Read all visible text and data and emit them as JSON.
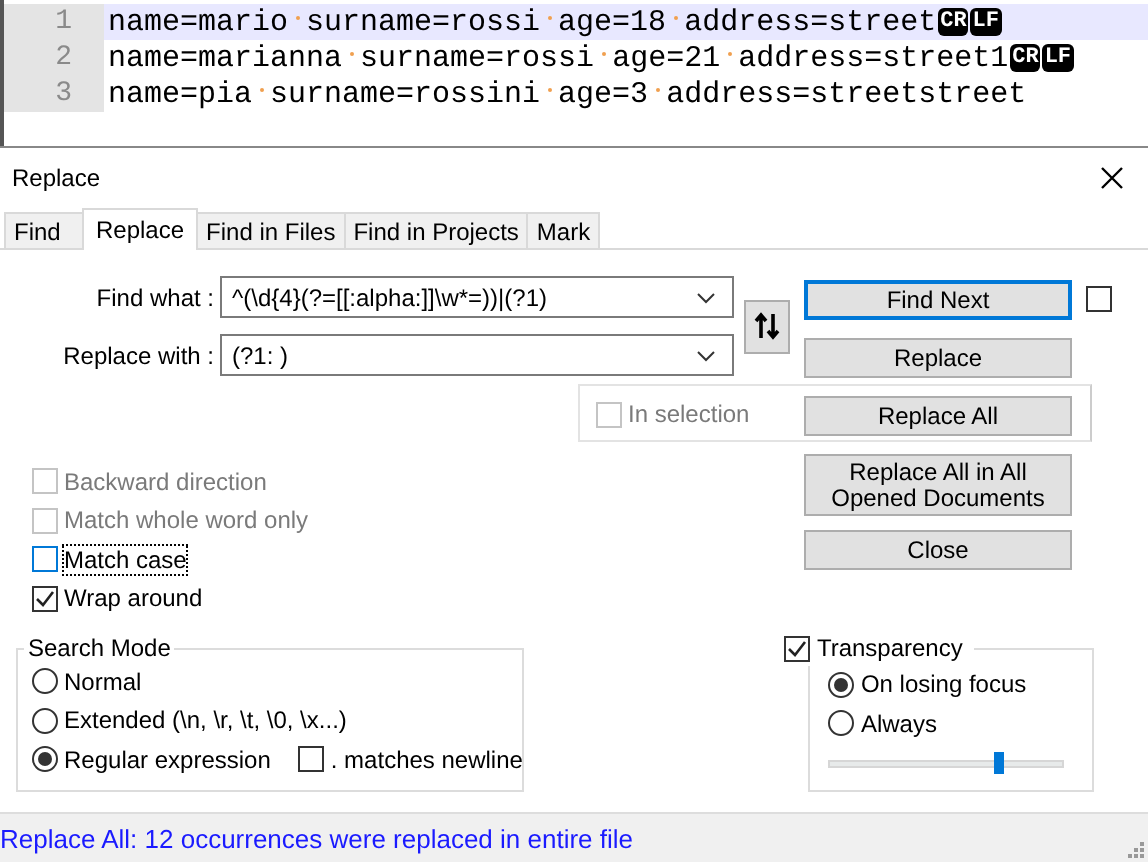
{
  "editor": {
    "lines": [
      {
        "number": "1",
        "words": [
          "name=mario",
          "surname=rossi",
          "age=18",
          "address=street"
        ],
        "eol": [
          "CR",
          "LF"
        ],
        "current": true
      },
      {
        "number": "2",
        "words": [
          "name=marianna",
          "surname=rossi",
          "age=21",
          "address=street1"
        ],
        "eol": [
          "CR",
          "LF"
        ],
        "current": false
      },
      {
        "number": "3",
        "words": [
          "name=pia",
          "surname=rossini",
          "age=3",
          "address=streetstreet"
        ],
        "current": false
      }
    ]
  },
  "dialog": {
    "title": "Replace",
    "tabs": [
      {
        "label": "Find",
        "selected": false
      },
      {
        "label": "Replace",
        "selected": true
      },
      {
        "label": "Find in Files",
        "selected": false
      },
      {
        "label": "Find in Projects",
        "selected": false
      },
      {
        "label": "Mark",
        "selected": false
      }
    ],
    "find_what": {
      "label": "Find what :",
      "value": "^(\\d{4}(?=[[:alpha:]]\\w*=))|(?1)"
    },
    "replace_with": {
      "label": "Replace with :",
      "value": "(?1: )"
    },
    "buttons": [
      {
        "label": "Find Next",
        "focused": true
      },
      {
        "label": "Replace",
        "focused": false
      },
      {
        "label": "Replace All",
        "focused": false
      },
      {
        "label": "Replace All in All Opened Documents",
        "focused": false
      },
      {
        "label": "Close",
        "focused": false
      }
    ],
    "side_checkbox": {
      "checked": false
    },
    "in_selection": {
      "label": "In selection",
      "checked": false,
      "disabled": true
    },
    "options": [
      {
        "label": "Backward direction",
        "checked": false,
        "disabled": true,
        "focused": false
      },
      {
        "label": "Match whole word only",
        "checked": false,
        "disabled": true,
        "focused": false
      },
      {
        "label": "Match case",
        "checked": false,
        "disabled": false,
        "focused": true
      },
      {
        "label": "Wrap around",
        "checked": true,
        "disabled": false,
        "focused": false
      }
    ],
    "search_mode": {
      "title": "Search Mode",
      "modes": [
        {
          "label": "Normal",
          "selected": false
        },
        {
          "label": "Extended (\\n, \\r, \\t, \\0, \\x...)",
          "selected": false
        },
        {
          "label": "Regular expression",
          "selected": true
        }
      ],
      "dot_matches_newline": {
        "label": ". matches newline",
        "checked": false
      }
    },
    "transparency": {
      "label": "Transparency",
      "checked": true,
      "modes": [
        {
          "label": "On losing focus",
          "selected": true
        },
        {
          "label": "Always",
          "selected": false
        }
      ],
      "level": 0.72
    },
    "status": "Replace All: 12 occurrences were replaced in entire file"
  }
}
